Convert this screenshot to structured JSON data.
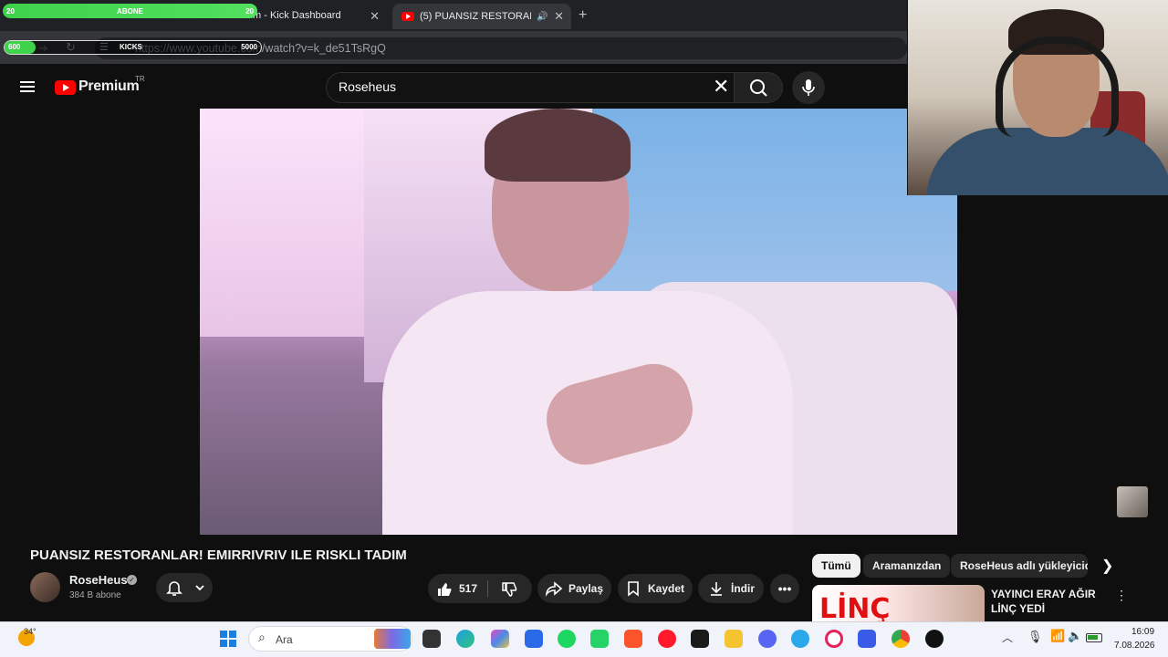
{
  "browser": {
    "tab1_title": "m - Kick Dashboard",
    "tab2_title": "(5) PUANSIZ RESTORANLAR",
    "close_glyph": "✕",
    "newtab_glyph": "+",
    "url": "https://www.youtube.com/watch?v=k_de51TsRgQ"
  },
  "overlays": {
    "abone": {
      "label": "ABONE",
      "min": "20",
      "max": "20",
      "progress": 1.0
    },
    "kicks": {
      "label": "KICKS",
      "min": "600",
      "max": "5000",
      "progress": 0.12
    }
  },
  "header": {
    "brand": "Premium",
    "region": "TR",
    "search_value": "Roseheus"
  },
  "video": {
    "title": "PUANSIZ RESTORANLAR! EMIRRIVRIV ILE RISKLI TADIM",
    "channel": "RoseHeus",
    "subscribers": "384 B abone",
    "likes": "517",
    "share": "Paylaş",
    "save": "Kaydet",
    "download": "İndir"
  },
  "sidebar": {
    "chips": [
      "Tümü",
      "Aramanızdan",
      "RoseHeus adlı yükleyiciden"
    ],
    "recommended": {
      "thumb_text": "LİNÇ",
      "title": "YAYINCI ERAY AĞIR LİNÇ YEDİ"
    }
  },
  "taskbar": {
    "weather_temp": "34°",
    "search_placeholder": "Ara",
    "time": "16:09",
    "date": "7.08.2026"
  },
  "colors": {
    "youtube_red": "#ff0000",
    "overlay_green": "#3fd24b",
    "page_bg": "#0f0f0f"
  }
}
